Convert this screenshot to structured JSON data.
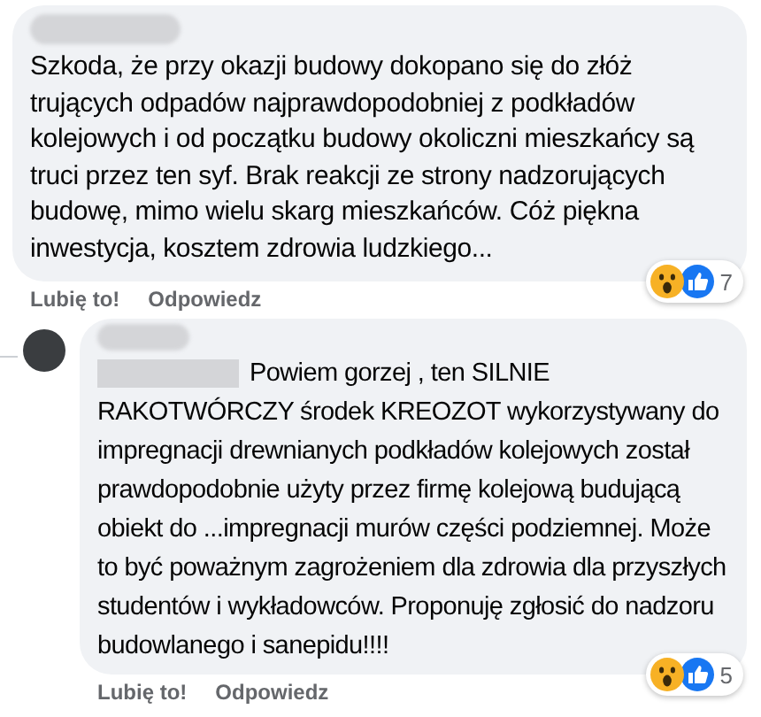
{
  "comments": [
    {
      "kind": "comment",
      "text": "Szkoda, że przy okazji budowy dokopano się do złóż trujących odpadów najprawdopodobniej z podkładów kolejowych i od początku budowy okoliczni mieszkańcy są truci przez ten syf. Brak reakcji ze strony nadzorujących budowę, mimo wielu skarg mieszkańców. Cóż piękna inwestycja, kosztem zdrowia ludzkiego...",
      "reaction_count": "7",
      "actions": [
        "Lubię to!",
        "Odpowiedz"
      ]
    },
    {
      "kind": "reply",
      "text": "Powiem gorzej , ten SILNIE RAKOTWÓRCZY środek KREOZOT wykorzystywany do impregnacji drewnianych podkładów kolejowych został prawdopodobnie użyty przez firmę kolejową budującą obiekt do ...impregnacji murów części podziemnej. Może to być poważnym zagrożeniem dla zdrowia dla przyszłych studentów i wykładowców. Proponuję zgłosić do nadzoru budowlanego i sanepidu!!!!",
      "reaction_count": "5",
      "actions": [
        "Lubię to!",
        "Odpowiedz"
      ]
    }
  ]
}
